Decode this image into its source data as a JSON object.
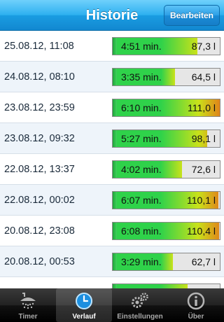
{
  "header": {
    "title": "Historie",
    "edit_label": "Bearbeiten"
  },
  "rows": [
    {
      "date": "25.08.12, 11:08",
      "duration": "4:51 min.",
      "volume": "87,3 l",
      "level": 0.79
    },
    {
      "date": "24.08.12, 08:10",
      "duration": "3:35 min.",
      "volume": "64,5 l",
      "level": 0.58
    },
    {
      "date": "23.08.12, 23:59",
      "duration": "6:10 min.",
      "volume": "111,0 l",
      "level": 1.0
    },
    {
      "date": "23.08.12, 09:32",
      "duration": "5:27 min.",
      "volume": "98,1 l",
      "level": 0.88
    },
    {
      "date": "22.08.12, 13:37",
      "duration": "4:02 min.",
      "volume": "72,6 l",
      "level": 0.65
    },
    {
      "date": "22.08.12, 00:02",
      "duration": "6:07 min.",
      "volume": "110,1 l",
      "level": 0.99
    },
    {
      "date": "20.08.12, 23:08",
      "duration": "6:08 min.",
      "volume": "110,4 l",
      "level": 0.995
    },
    {
      "date": "20.08.12, 00:53",
      "duration": "3:29 min.",
      "volume": "62,7 l",
      "level": 0.565
    },
    {
      "date": "",
      "duration": "",
      "volume": "",
      "level": 0.7
    }
  ],
  "tabs": [
    {
      "label": "Timer",
      "icon": "shower-icon",
      "active": false
    },
    {
      "label": "Verlauf",
      "icon": "clock-icon",
      "active": true
    },
    {
      "label": "Einstellungen",
      "icon": "gears-icon",
      "active": false
    },
    {
      "label": "Über",
      "icon": "info-icon",
      "active": false
    }
  ],
  "colors": {
    "low": "#2fd24a",
    "mid": "#c9e21a",
    "high": "#e0841a"
  }
}
